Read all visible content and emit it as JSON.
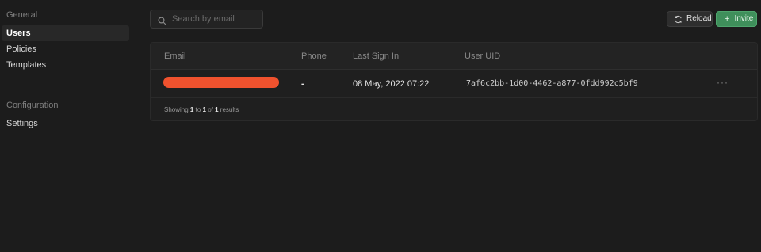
{
  "sidebar": {
    "general_title": "General",
    "items": [
      {
        "label": "Users"
      },
      {
        "label": "Policies"
      },
      {
        "label": "Templates"
      }
    ],
    "configuration_title": "Configuration",
    "config_items": [
      {
        "label": "Settings"
      }
    ]
  },
  "search": {
    "placeholder": "Search by email"
  },
  "toolbar": {
    "reload_label": "Reload",
    "invite_label": "Invite"
  },
  "table": {
    "columns": [
      "Email",
      "Phone",
      "Last Sign In",
      "User UID"
    ],
    "rows": [
      {
        "email": "",
        "phone": "-",
        "last_sign_in": "08 May, 2022 07:22",
        "uid": "7af6c2bb-1d00-4462-a877-0fdd992c5bf9",
        "actions": "···"
      }
    ],
    "footer": {
      "prefix": "Showing",
      "from": "1",
      "to_word": "to",
      "to": "1",
      "of_word": "of",
      "total": "1",
      "suffix": "results"
    }
  },
  "colors": {
    "accent": "#3f8f5b",
    "redaction": "#f0522e"
  }
}
